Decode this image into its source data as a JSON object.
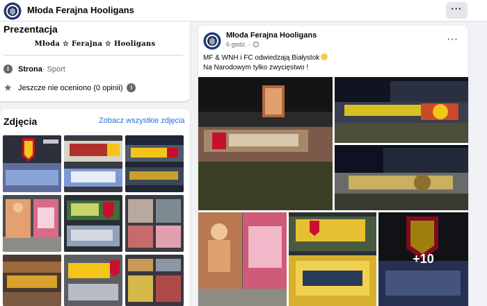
{
  "header": {
    "page_name": "Młoda Ferajna Hooligans"
  },
  "intro": {
    "title": "Prezentacja",
    "bio": "Młoda ☆ Ferajna ☆ Hooligans",
    "category_label": "Strona",
    "category_value": " · Sport",
    "rating": "Jeszcze nie oceniono (0 opinii)"
  },
  "photos": {
    "title": "Zdjęcia",
    "see_all": "Zobacz wszystkie zdjęcia"
  },
  "post": {
    "author": "Młoda Ferajna Hooligans",
    "time": "6 godz.",
    "line1": "MF & WNH i FC odwiedzają Białystok",
    "line2": "Na Narodowym tylko zwycięstwo !",
    "more_count": "+10"
  },
  "colors": {
    "accent_link": "#216fdb",
    "card_bg": "#ffffff",
    "page_bg": "#f0f2f5",
    "badge_yellow": "#f4c518",
    "badge_red": "#c8102e"
  }
}
